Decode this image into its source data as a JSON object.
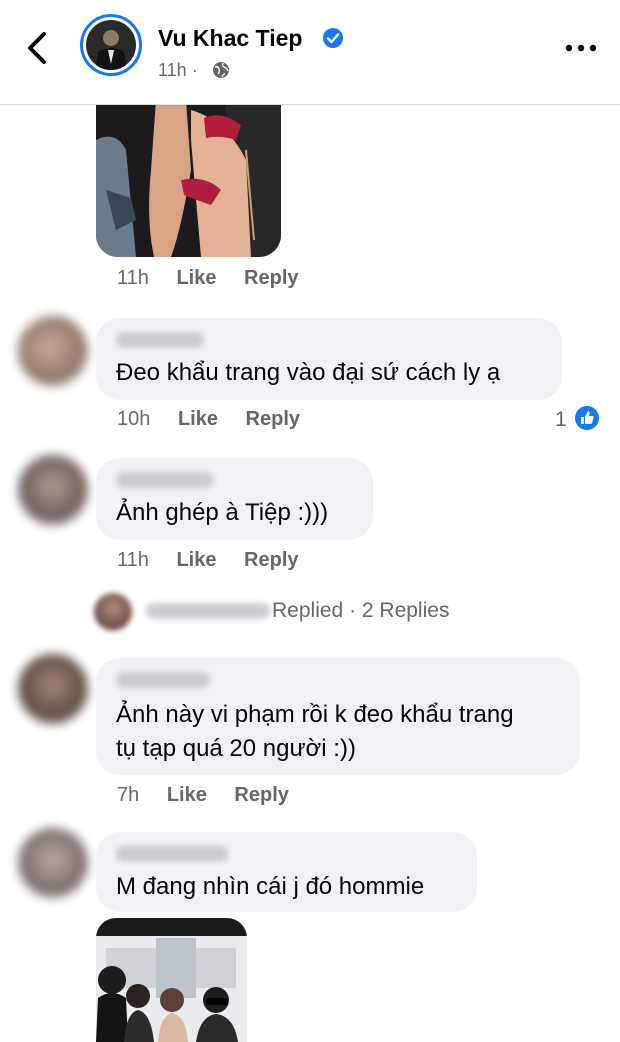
{
  "header": {
    "name": "Vu Khac Tiep",
    "time": "11h",
    "separator": "·"
  },
  "colors": {
    "accent": "#1877f2",
    "bubble": "#f0f2f5",
    "meta": "#65676b"
  },
  "actions": {
    "like": "Like",
    "reply": "Reply"
  },
  "comments": [
    {
      "time": "11h"
    },
    {
      "text": "Đeo khẩu trang vào đại sứ cách ly ạ",
      "time": "10h",
      "reactions": "1"
    },
    {
      "text": "Ảnh ghép à Tiệp :)))",
      "time": "11h"
    },
    {
      "text_line1": "Ảnh này vi phạm rồi k đeo khẩu trang",
      "text_line2": "tụ tạp quá 20 người :))",
      "time": "7h"
    },
    {
      "text": "M đang nhìn cái j đó hommie"
    }
  ],
  "reply_summary": {
    "replied": "Replied",
    "count": "· 2 Replies"
  },
  "icons": [
    "back-chevron-icon",
    "verified-badge-icon",
    "globe-icon",
    "more-dots-icon",
    "like-reaction-icon"
  ]
}
